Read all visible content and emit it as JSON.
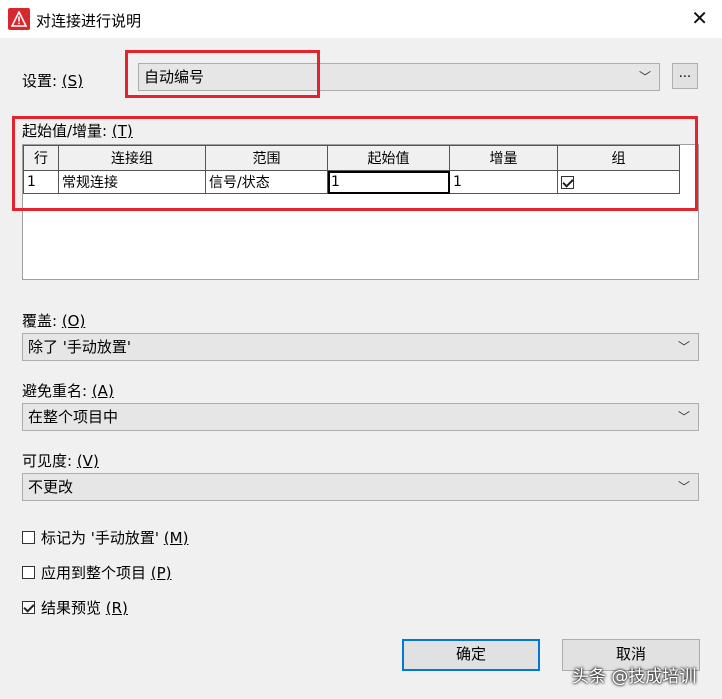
{
  "window": {
    "title": "对连接进行说明",
    "close_glyph": "✕"
  },
  "settings": {
    "label": "设置: ",
    "mnemonic": "(S)",
    "value": "自动编号",
    "browse_label": "..."
  },
  "start_increment": {
    "label": "起始值/增量: ",
    "mnemonic": "(T)",
    "columns": [
      "行",
      "连接组",
      "范围",
      "起始值",
      "增量",
      "组"
    ],
    "rows": [
      {
        "row": "1",
        "group": "常规连接",
        "scope": "信号/状态",
        "start": "1",
        "increment": "1",
        "grouped": true
      }
    ]
  },
  "overwrite": {
    "label": "覆盖: ",
    "mnemonic": "(O)",
    "value": "除了 '手动放置'"
  },
  "avoid_duplicates": {
    "label": "避免重名: ",
    "mnemonic": "(A)",
    "value": "在整个项目中"
  },
  "visibility": {
    "label": "可见度: ",
    "mnemonic": "(V)",
    "value": "不更改"
  },
  "checkboxes": [
    {
      "label": "标记为 '手动放置' ",
      "mnemonic": "(M)",
      "checked": false
    },
    {
      "label": "应用到整个项目 ",
      "mnemonic": "(P)",
      "checked": false
    },
    {
      "label": "结果预览 ",
      "mnemonic": "(R)",
      "checked": true
    }
  ],
  "buttons": {
    "ok": "确定",
    "cancel": "取消"
  },
  "watermark": "头条 @技成培训",
  "colors": {
    "highlight": "#e3232e",
    "focus": "#0078d7",
    "app_icon": "#d9272e"
  },
  "icons": {
    "app": "warning-triangle-icon",
    "dropdown": "chevron-down-icon",
    "close": "close-icon"
  }
}
